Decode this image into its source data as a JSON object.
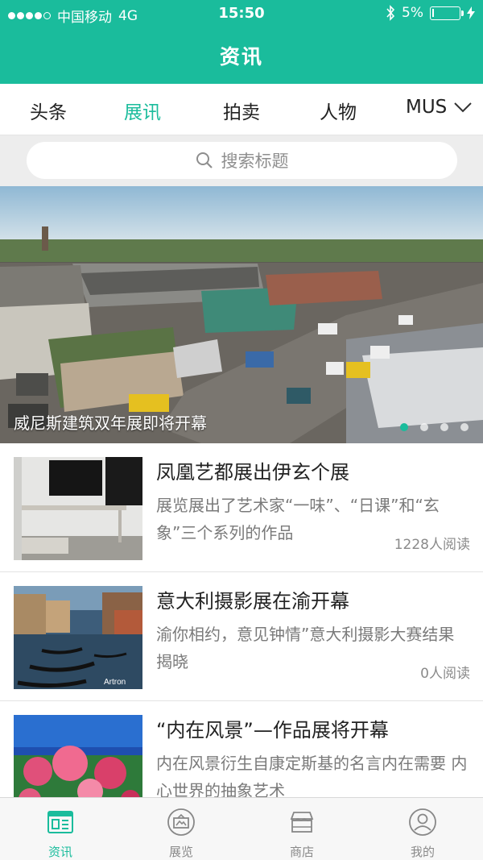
{
  "status_bar": {
    "carrier": "中国移动",
    "network": "4G",
    "time": "15:50",
    "battery_percent": "5%",
    "battery_level": 0.05
  },
  "nav": {
    "title": "资讯"
  },
  "tabs": {
    "items": [
      "头条",
      "展讯",
      "拍卖",
      "人物",
      "MUS"
    ],
    "active_index": 1
  },
  "search": {
    "placeholder": "搜索标题"
  },
  "banner": {
    "caption": "威尼斯建筑双年展即将开幕",
    "page_count": 4,
    "active_page": 0
  },
  "articles": [
    {
      "title": "凤凰艺都展出伊玄个展",
      "desc": "展览展出了艺术家“一味”、“日课”和“玄象”三个系列的作品",
      "reads": "1228人阅读"
    },
    {
      "title": "意大利摄影展在渝开幕",
      "desc": "渝你相约，意见钟情”意大利摄影大赛结果揭晓",
      "reads": "0人阅读",
      "watermark": "Artron"
    },
    {
      "title": "“内在风景”—作品展将开幕",
      "desc": "内在风景衍生自康定斯基的名言内在需要 内心世界的抽象艺术",
      "reads": ""
    }
  ],
  "tabbar": {
    "items": [
      {
        "label": "资讯",
        "icon": "news-icon"
      },
      {
        "label": "展览",
        "icon": "exhibition-icon"
      },
      {
        "label": "商店",
        "icon": "shop-icon"
      },
      {
        "label": "我的",
        "icon": "profile-icon"
      }
    ],
    "active_index": 0
  },
  "colors": {
    "accent": "#1abc9c",
    "text": "#222222",
    "muted": "#7a7a7a"
  }
}
